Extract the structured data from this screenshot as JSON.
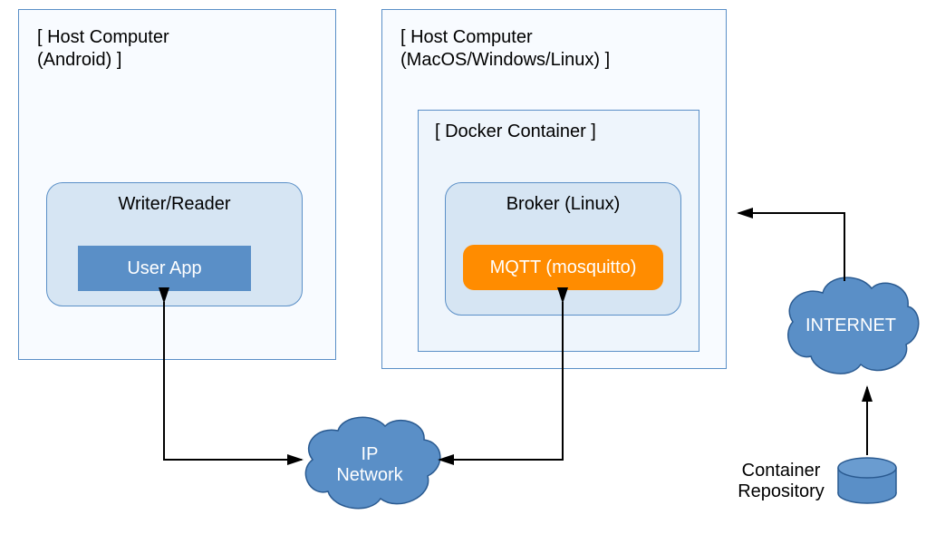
{
  "hosts": {
    "left": {
      "line1": "[ Host Computer",
      "line2": "  (Android) ]"
    },
    "right": {
      "line1": "[ Host Computer",
      "line2": "  (MacOS/Windows/Linux) ]"
    }
  },
  "docker": {
    "label": "[ Docker Container ]"
  },
  "writer_reader": {
    "title": "Writer/Reader",
    "app": "User App"
  },
  "broker": {
    "title": "Broker (Linux)",
    "app": "MQTT (mosquitto)"
  },
  "clouds": {
    "ip": "IP\nNetwork",
    "internet": "INTERNET"
  },
  "repo": {
    "label": "Container\nRepository"
  }
}
